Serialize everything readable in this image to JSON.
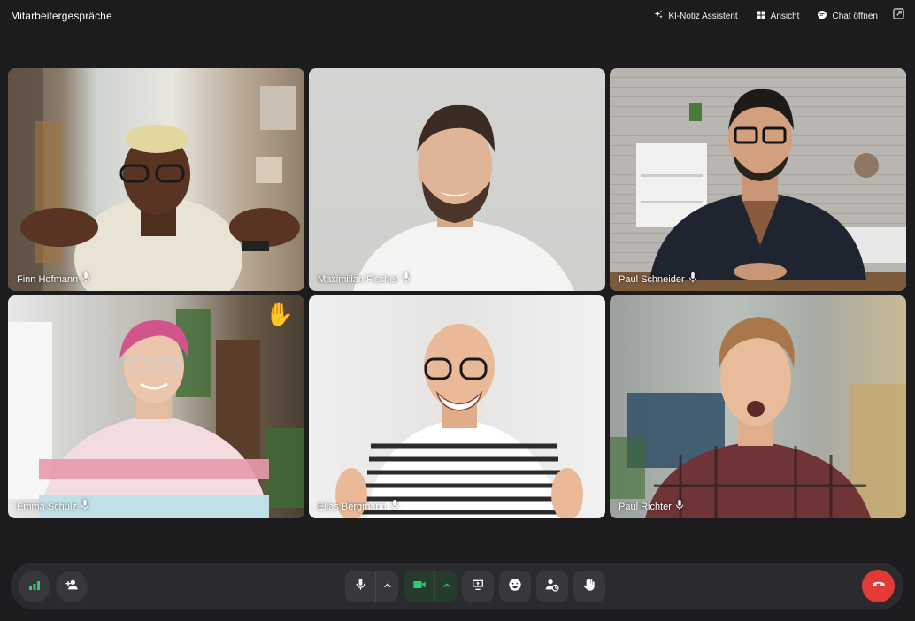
{
  "header": {
    "title": "Mitarbeitergespräche",
    "actions": [
      {
        "label": "KI-Notiz Assistent",
        "icon": "sparkle-icon"
      },
      {
        "label": "Ansicht",
        "icon": "grid-view-icon"
      },
      {
        "label": "Chat öffnen",
        "icon": "chat-bubble-icon"
      }
    ],
    "expand_icon": "expand-icon"
  },
  "participants": [
    {
      "name": "Finn Hofmann",
      "mic": "mic-icon",
      "hand_raised": false
    },
    {
      "name": "Maximilian Fischer",
      "mic": "mic-icon",
      "hand_raised": false
    },
    {
      "name": "Paul Schneider",
      "mic": "mic-icon",
      "hand_raised": false
    },
    {
      "name": "Emma Schulz",
      "mic": "mic-icon",
      "hand_raised": true,
      "hand_emoji": "✋"
    },
    {
      "name": "Elias Bergmann",
      "mic": "mic-icon",
      "hand_raised": false
    },
    {
      "name": "Paul Richter",
      "mic": "mic-icon",
      "hand_raised": false
    }
  ],
  "toolbar": {
    "left": [
      "connection-quality-icon",
      "add-person-icon"
    ],
    "center": [
      "mic-icon",
      "chevron-up-icon",
      "camera-icon",
      "chevron-up-icon",
      "share-screen-icon",
      "emoji-icon",
      "waiting-room-icon",
      "raise-hand-icon"
    ],
    "right": [
      "end-call-icon"
    ]
  },
  "colors": {
    "background": "#1c1c1f",
    "toolbar": "#2b2b2f",
    "button": "#38383c",
    "camera_active": "#2ecc71",
    "signal": "#2ecc71",
    "end_call": "#e53935",
    "hand": "#f5a623"
  }
}
